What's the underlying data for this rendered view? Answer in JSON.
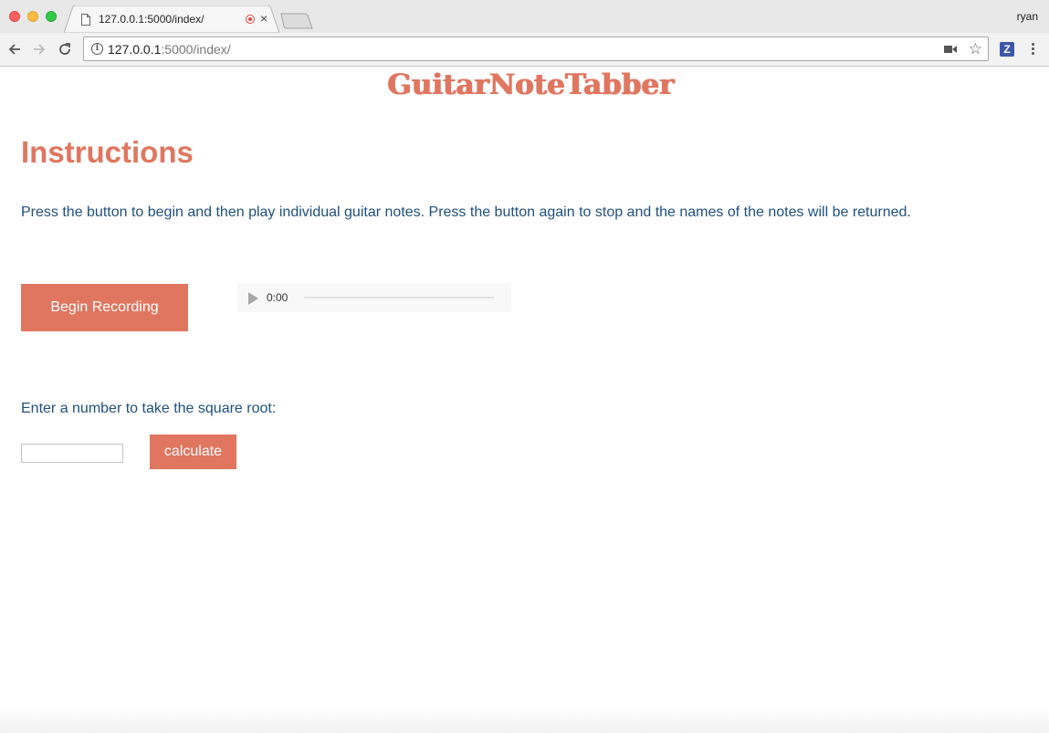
{
  "browser": {
    "tab_title": "127.0.0.1:5000/index/",
    "profile_name": "ryan",
    "url_host": "127.0.0.1",
    "url_rest": ":5000/index/",
    "extension_label": "Z",
    "close_glyph": "×",
    "star_glyph": "☆",
    "info_glyph": "i"
  },
  "page": {
    "logo": "GuitarNoteTabber",
    "heading": "Instructions",
    "instructions": "Press the button to begin and then play individual guitar notes. Press the button again to stop and the names of the notes will be returned.",
    "record_button_label": "Begin Recording",
    "audio_time": "0:00",
    "sqrt_label": "Enter a number to take the square root:",
    "number_input_value": "",
    "calculate_button_label": "calculate"
  },
  "colors": {
    "accent": "#e07660",
    "text_blue": "#1f4f7e"
  },
  "icons": [
    "file-icon",
    "record-indicator-icon",
    "close-icon",
    "back-arrow-icon",
    "forward-arrow-icon",
    "reload-icon",
    "info-icon",
    "camera-icon",
    "star-icon",
    "menu-icon",
    "play-icon"
  ]
}
